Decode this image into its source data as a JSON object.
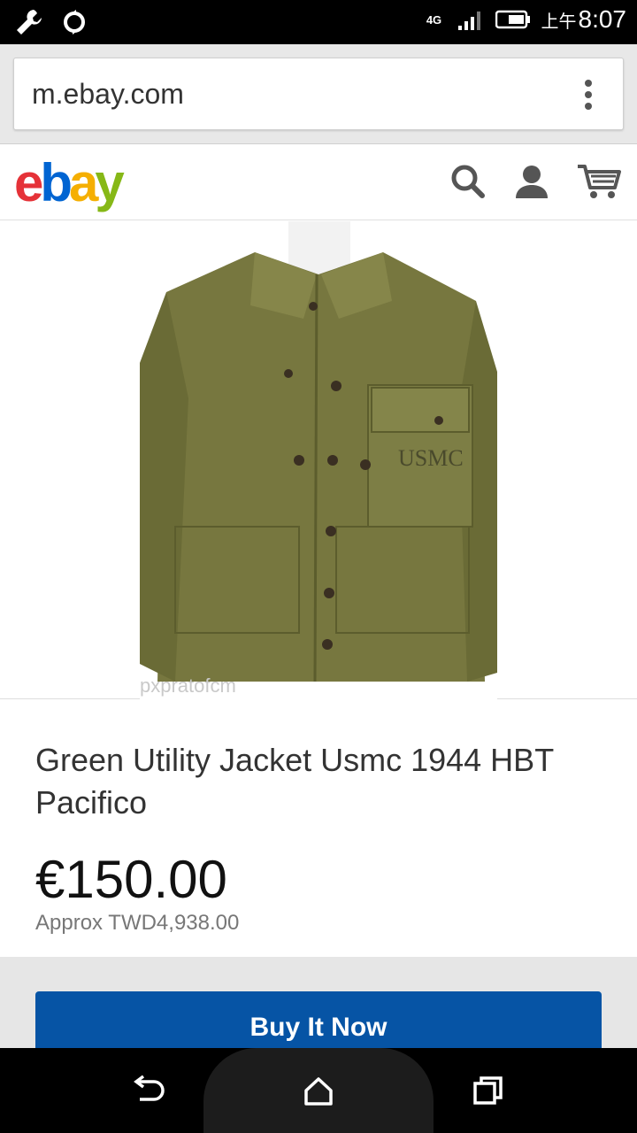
{
  "status_bar": {
    "network": "4G",
    "time_prefix": "上午",
    "time": "8:07"
  },
  "browser": {
    "url": "m.ebay.com"
  },
  "header": {
    "logo": {
      "e": "e",
      "b": "b",
      "a": "a",
      "y": "y"
    },
    "icons": [
      "search-icon",
      "user-icon",
      "cart-icon"
    ]
  },
  "product": {
    "watermark": "pxpratofcm",
    "title": "Green Utility Jacket Usmc 1944 HBT Pacifico",
    "price": "€150.00",
    "approx_price": "Approx TWD4,938.00",
    "image_text": "USMC"
  },
  "actions": {
    "buy_now_label": "Buy It Now"
  },
  "colors": {
    "ebay_red": "#e53238",
    "ebay_blue": "#0064d2",
    "ebay_yellow": "#f5af02",
    "ebay_green": "#86b817",
    "buy_button": "#0654a5"
  }
}
